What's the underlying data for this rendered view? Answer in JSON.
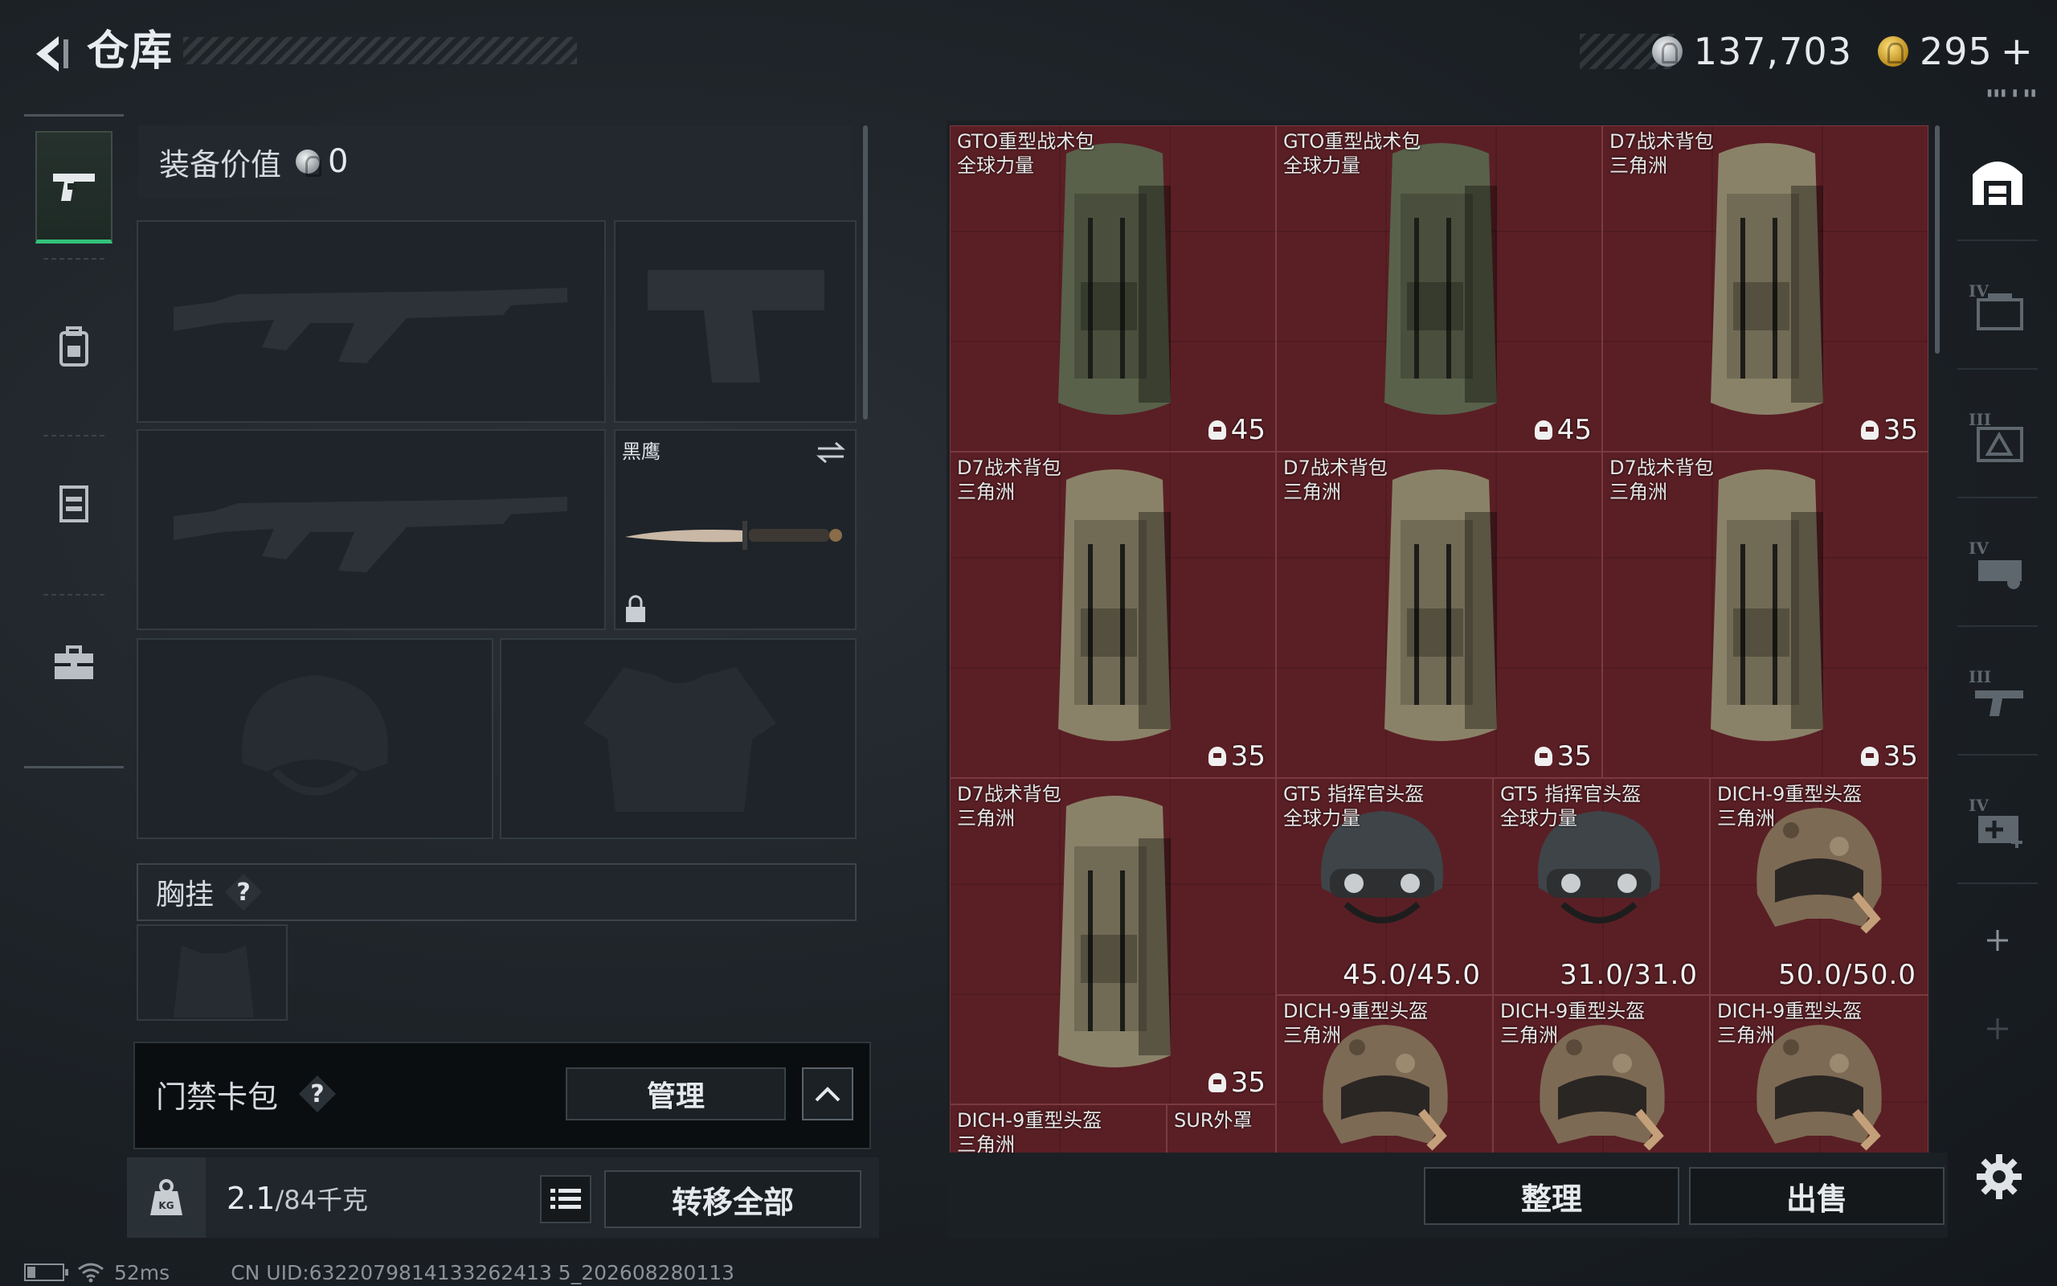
{
  "header": {
    "title": "仓库",
    "silver": "137,703",
    "gold": "295",
    "plus": "+",
    "tiny": "▮▮▮ ▮ ▮▮"
  },
  "nav": {
    "items": [
      "pistol-icon",
      "backpack-icon",
      "vest-icon",
      "toolbox-icon"
    ]
  },
  "equip": {
    "value_label": "装备价值",
    "value": "0",
    "melee_name": "黑鹰",
    "chest_label": "胸挂",
    "help": "?"
  },
  "card": {
    "label": "门禁卡包",
    "help": "?",
    "manage": "管理"
  },
  "weight": {
    "current": "2.1",
    "capacity": "/84千克",
    "transfer_all": "转移全部"
  },
  "status": {
    "ping": "52ms",
    "uid": "CN UID:6322079814133262413 5_202608280113"
  },
  "inventory": {
    "items": [
      {
        "name": "GTO重型战术包\n全球力量",
        "value": "45"
      },
      {
        "name": "GTO重型战术包\n全球力量",
        "value": "45"
      },
      {
        "name": "D7战术背包\n三角洲",
        "value": "35"
      },
      {
        "name": "D7战术背包\n三角洲",
        "value": "35"
      },
      {
        "name": "D7战术背包\n三角洲",
        "value": "35"
      },
      {
        "name": "D7战术背包\n三角洲",
        "value": "35"
      },
      {
        "name": "D7战术背包\n三角洲",
        "value": "35"
      },
      {
        "name": "GT5 指挥官头盔\n全球力量",
        "dur": "45.0/45.0"
      },
      {
        "name": "GT5 指挥官头盔\n全球力量",
        "dur": "31.0/31.0"
      },
      {
        "name": "DICH-9重型头盔\n三角洲",
        "dur": "50.0/50.0"
      },
      {
        "name": "DICH-9重型头盔\n三角洲",
        "dur": ""
      },
      {
        "name": "DICH-9重型头盔\n三角洲",
        "dur": ""
      },
      {
        "name": "DICH-9重型头盔\n三角洲",
        "dur": ""
      },
      {
        "name": "DICH-9重型头盔\n三角洲",
        "dur": ""
      },
      {
        "name": "SUR外罩",
        "dur": ""
      }
    ],
    "sort": "整理",
    "sell": "出售"
  },
  "rightbar": {
    "tiers": [
      "",
      "IV",
      "III",
      "IV",
      "III",
      "IV",
      "+",
      "+"
    ]
  },
  "colors": {
    "accent_green": "#33c27a",
    "item_bg": "#5a1f25"
  }
}
